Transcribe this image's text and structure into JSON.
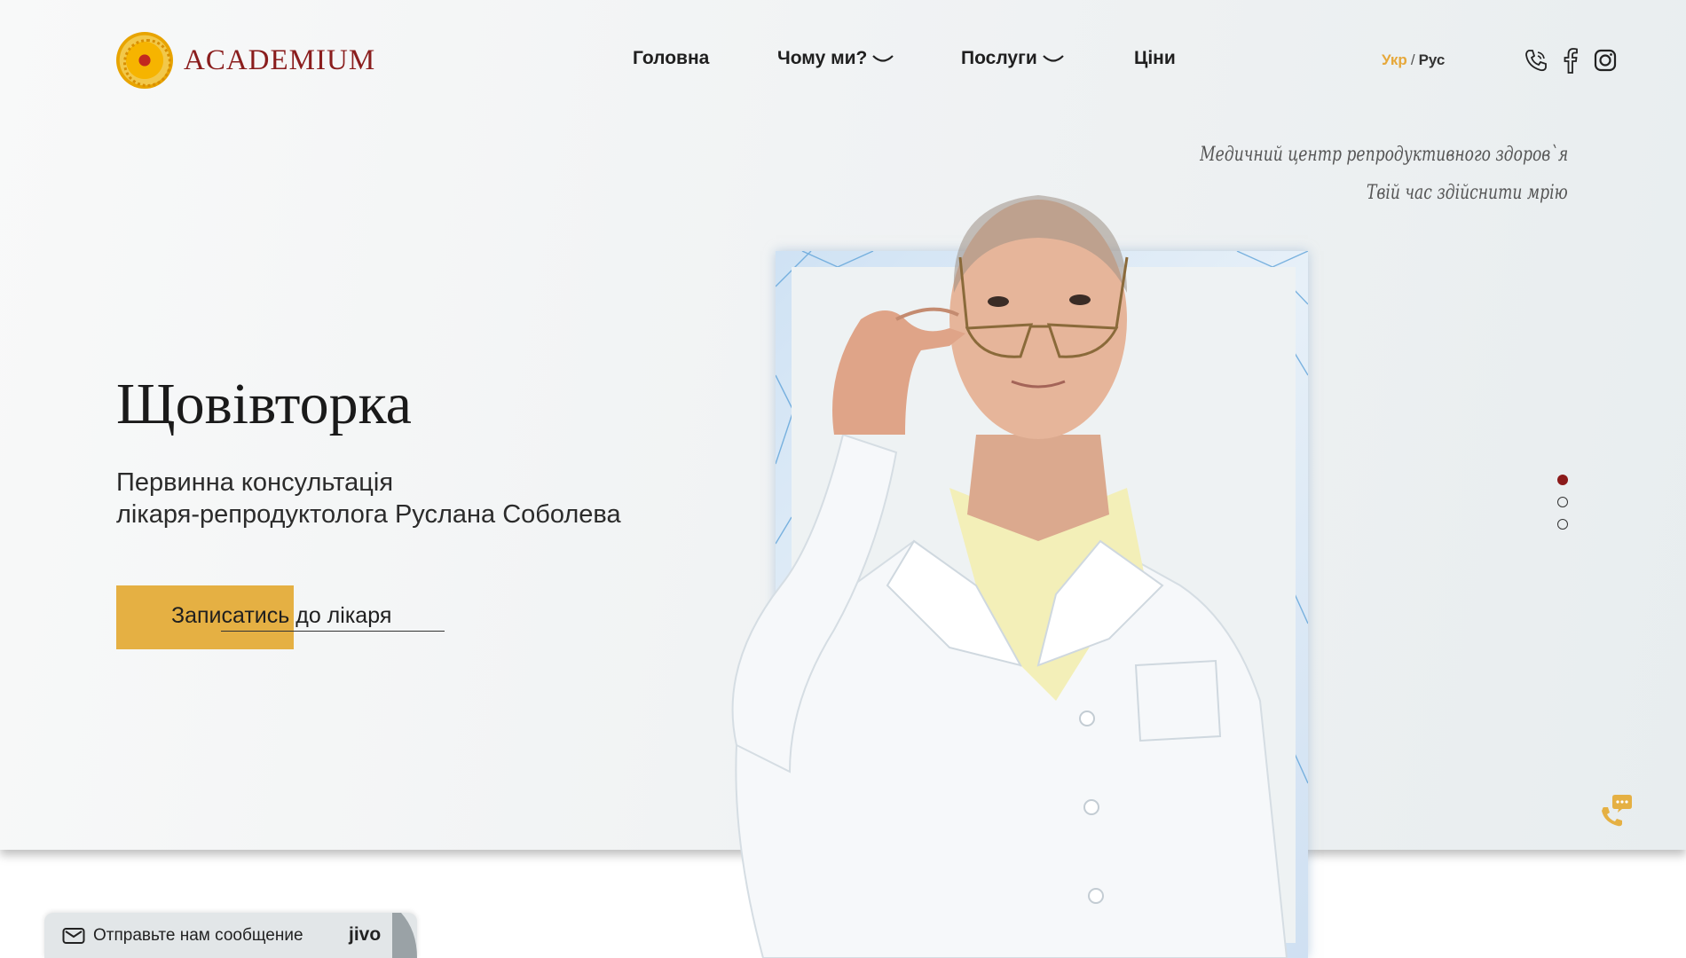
{
  "header": {
    "logo_text": "ACADEMIUM",
    "logo_icon": "sunflower-logo-icon",
    "nav": [
      {
        "label": "Головна",
        "has_dropdown": false
      },
      {
        "label": "Чому ми?",
        "has_dropdown": true
      },
      {
        "label": "Послуги",
        "has_dropdown": true
      },
      {
        "label": "Ціни",
        "has_dropdown": false
      }
    ],
    "lang_active": "Укр",
    "lang_separator": "/",
    "lang_other": "Рус",
    "social_icons": [
      "phone-icon",
      "facebook-icon",
      "instagram-icon"
    ]
  },
  "tagline": {
    "line1": "Медичний центр репродуктивного здоров`я",
    "line2": "Твій час здійснити мрію"
  },
  "hero": {
    "title": "Щовівторка",
    "subtitle_line1": "Первинна консультація",
    "subtitle_line2": "лікаря-репродуктолога Руслана Соболева",
    "cta_label": "Записатись до лікаря",
    "image": "doctor-portrait"
  },
  "slider": {
    "count": 3,
    "active_index": 0
  },
  "widgets": {
    "callback_icon": "callback-phone-icon",
    "jivo_message": "Отправьте нам сообщение",
    "jivo_brand": "jivo"
  },
  "colors": {
    "accent": "#e5b043",
    "brand": "#8a1d1d",
    "slider_active": "#8b1a1a"
  }
}
